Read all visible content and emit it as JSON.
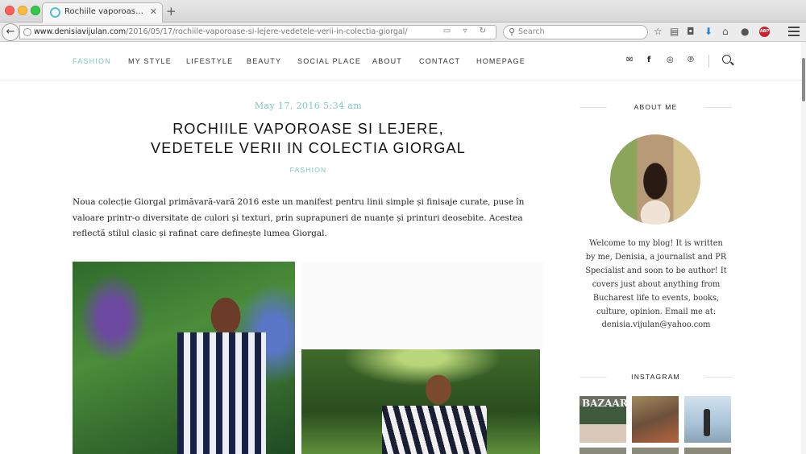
{
  "browser": {
    "tab_title": "Rochiile vaporoase si lejer...",
    "tab_close": "✕",
    "new_tab": "+",
    "back": "←",
    "url_domain": "www.denisiavijulan.com",
    "url_path": "/2016/05/17/rochiile-vaporoase-si-lejere-vedetele-verii-in-colectia-giorgal/",
    "url_icons": "▭ ▿ ↻",
    "search_placeholder": "Search",
    "search_glyph": "⚲",
    "toolbar_icons": {
      "star": "☆",
      "reading": "▤",
      "pocket": "◘",
      "download": "⬇",
      "home": "⌂",
      "chat": "●",
      "abp": "ABP"
    }
  },
  "nav": {
    "items": [
      {
        "label": "FASHION",
        "active": true
      },
      {
        "label": "MY STYLE"
      },
      {
        "label": "LIFESTYLE"
      },
      {
        "label": "BEAUTY"
      },
      {
        "label": "SOCIAL PLACE"
      },
      {
        "label": "ABOUT"
      },
      {
        "label": "CONTACT"
      },
      {
        "label": "HOMEPAGE"
      }
    ],
    "social": {
      "email": "✉",
      "facebook": "f",
      "instagram": "◎",
      "pinterest": "℗"
    }
  },
  "post": {
    "date": "May 17, 2016 5:34 am",
    "title_line1": "ROCHIILE VAPOROASE SI LEJERE,",
    "title_line2": "VEDETELE VERII IN COLECTIA GIORGAL",
    "category": "FASHION",
    "body": "Noua colecție Giorgal primăvară-vară 2016 este un manifest pentru linii simple și finisaje curate, puse în valoare printr-o diversitate de culori și texturi, prin suprapuneri de nuanțe și printuri deosebite. Acestea reflectă stilul clasic și rafinat care definește lumea Giorgal."
  },
  "sidebar": {
    "about_heading": "ABOUT ME",
    "about_text": "Welcome to my blog! It is written by me, Denisia, a journalist and PR Specialist and soon to be author! It covers just about anything from Bucharest life to events, books, culture, opinion. Email me at: denisia.vijulan@yahoo.com",
    "instagram_heading": "INSTAGRAM",
    "insta_1_text": "BAZAAR"
  }
}
